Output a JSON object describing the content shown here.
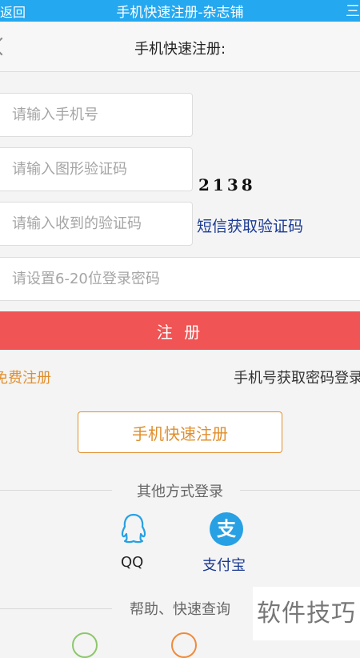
{
  "topbar": {
    "back": "返回",
    "title": "手机快速注册-杂志铺",
    "menu": "三"
  },
  "subbar": {
    "title": "手机快速注册:"
  },
  "form": {
    "phone_placeholder": "请输入手机号",
    "captcha_placeholder": "请输入图形验证码",
    "captcha_text": "2138",
    "sms_placeholder": "请输入收到的验证码",
    "sms_link": "短信获取验证码",
    "password_placeholder": "请设置6-20位登录密码",
    "register": "注 册"
  },
  "links": {
    "free_register": "免费注册",
    "get_password": "手机号获取密码登录"
  },
  "quick_register": "手机快速注册",
  "other_login": {
    "title": "其他方式登录",
    "items": [
      {
        "label": "QQ",
        "icon": "qq-icon"
      },
      {
        "label": "支付宝",
        "icon": "alipay-icon",
        "glyph": "支"
      }
    ]
  },
  "help": {
    "title": "帮助、快速查询"
  },
  "watermark": "软件技巧",
  "colors": {
    "topbar": "#24a8f0",
    "register": "#f05454",
    "accent": "#e08f2e",
    "link": "#1b3a93"
  }
}
